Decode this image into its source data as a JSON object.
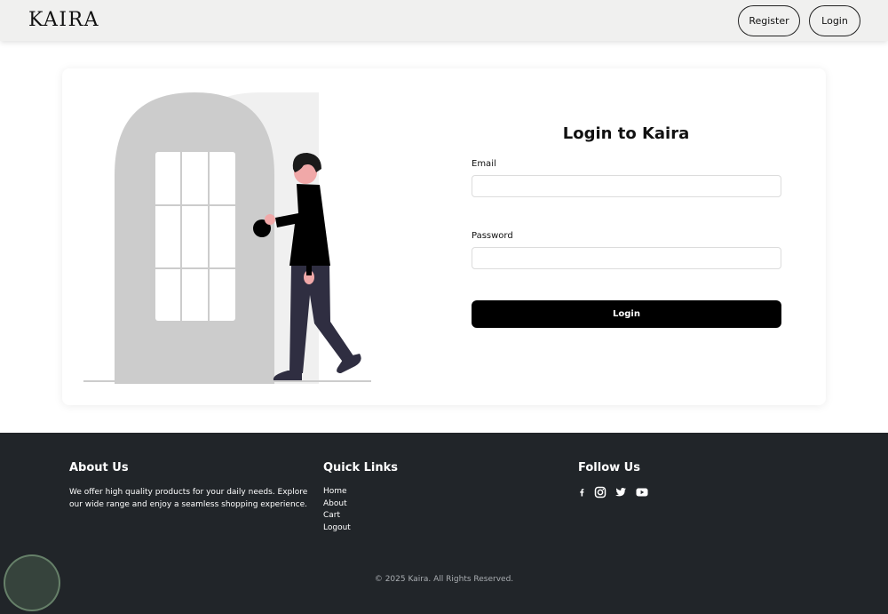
{
  "header": {
    "logo": "KAIRA",
    "register_label": "Register",
    "login_label": "Login"
  },
  "form": {
    "title": "Login to Kaira",
    "email_label": "Email",
    "email_value": "",
    "password_label": "Password",
    "password_value": "",
    "submit_label": "Login"
  },
  "footer": {
    "about": {
      "heading": "About Us",
      "text": "We offer high quality products for your daily needs. Explore our wide range and enjoy a seamless shopping experience."
    },
    "quick_links": {
      "heading": "Quick Links",
      "items": [
        "Home",
        "About",
        "Cart",
        "Logout"
      ]
    },
    "follow": {
      "heading": "Follow Us",
      "icons": [
        "facebook-icon",
        "instagram-icon",
        "twitter-icon",
        "youtube-icon"
      ]
    },
    "copyright": "© 2025 Kaira. All Rights Reserved."
  },
  "colors": {
    "header_bg": "#f0f0ef",
    "footer_bg": "#212529",
    "button_bg": "#000000",
    "door": "#cccccc",
    "door_back": "#f0f0f0",
    "pants": "#2f2e41",
    "skin": "#f0a8a8"
  }
}
